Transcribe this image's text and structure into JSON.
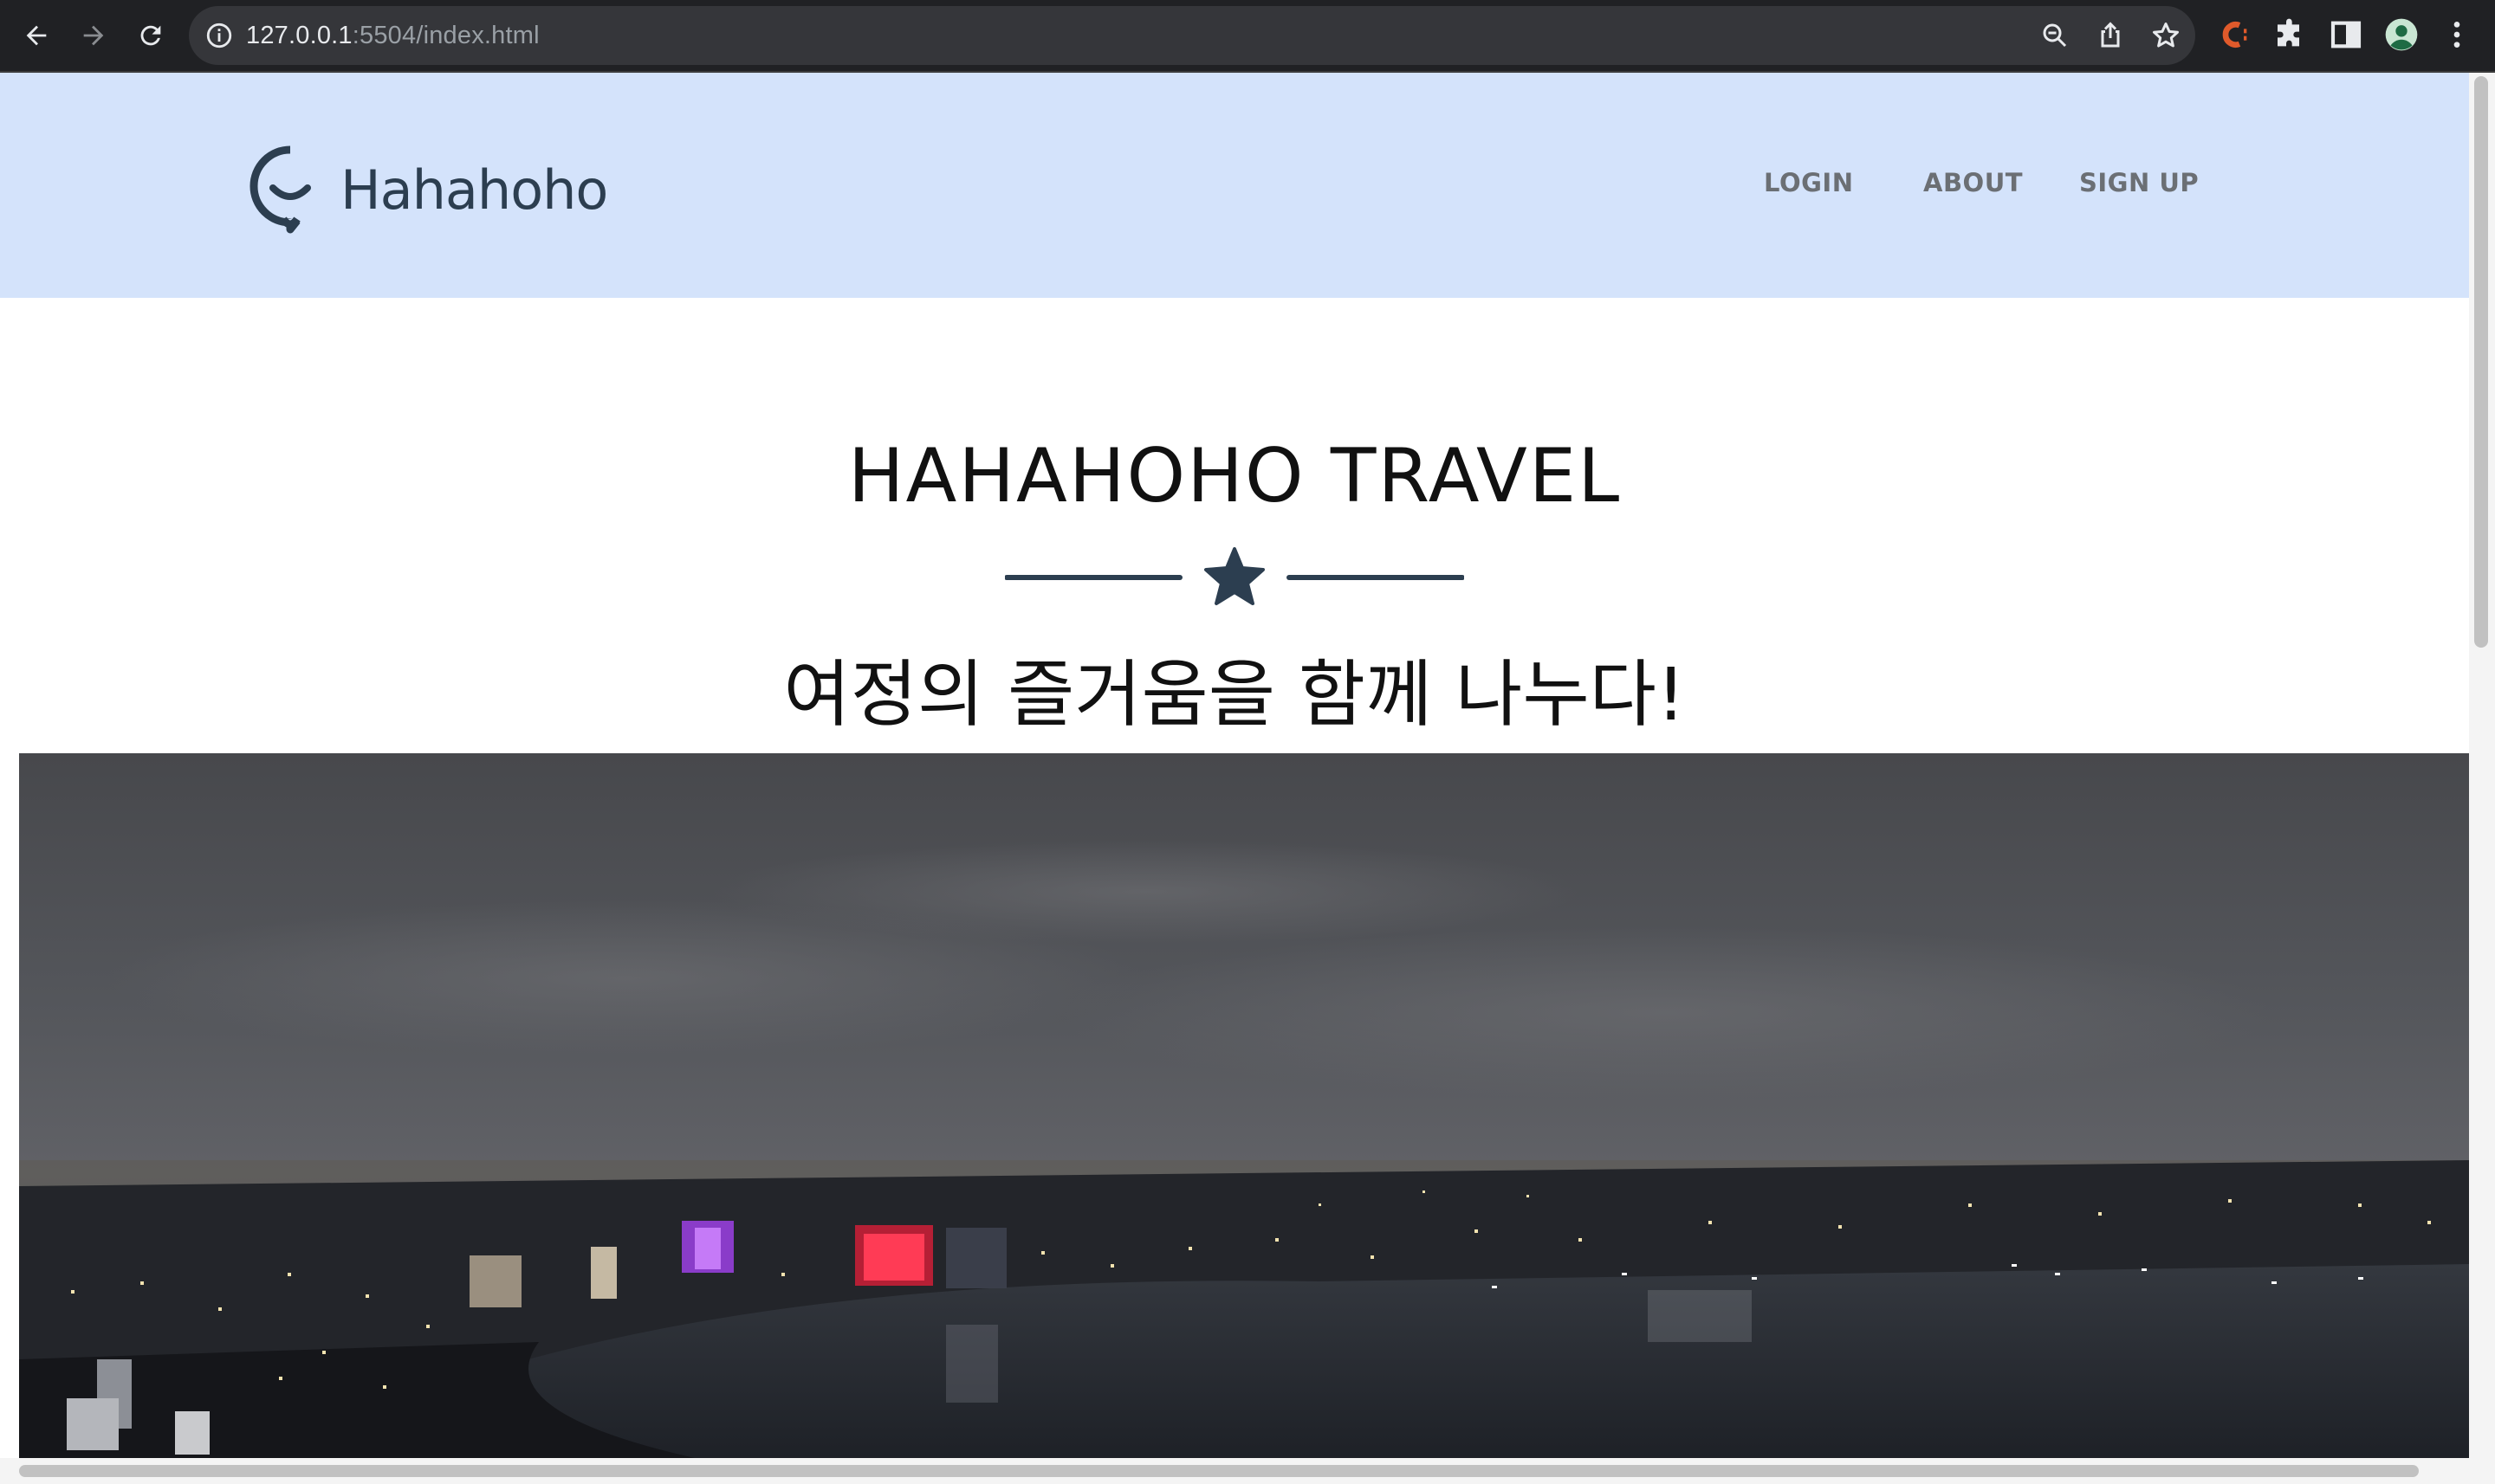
{
  "browser": {
    "url_host": "127.0.0.1",
    "url_rest": ":5504/index.html"
  },
  "site": {
    "logo_text": "Hahahoho",
    "nav": [
      {
        "label": "LOGIN"
      },
      {
        "label": "ABOUT"
      },
      {
        "label": "SIGN UP"
      }
    ]
  },
  "hero": {
    "title": "HAHAHOHO TRAVEL",
    "subtitle": "여정의 즐거움을 함께 나누다!"
  },
  "colors": {
    "header_bg": "#d4e3fb",
    "accent": "#2c3e50",
    "nav_text": "#6b6f74"
  }
}
